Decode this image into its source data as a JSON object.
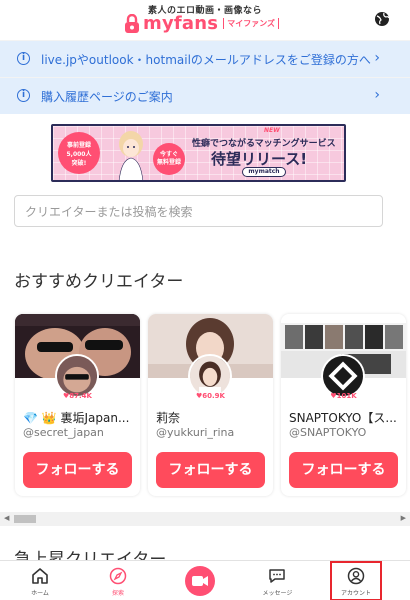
{
  "header": {
    "tagline": "素人のエロ動画・画像なら",
    "brand": "myfans",
    "brand_sub": "マイファンズ",
    "globe_icon": "globe-icon"
  },
  "notices": [
    {
      "text": "live.jpやoutlook・hotmailのメールアドレスをご登録の方へ"
    },
    {
      "text": "購入履歴ページのご案内"
    }
  ],
  "promo": {
    "badge_left": [
      "事前登録",
      "5,000人",
      "突破!"
    ],
    "badge_right": [
      "今すぐ",
      "無料登録"
    ],
    "new_label": "NEW",
    "line1": "性癖でつながるマッチングサービス",
    "line2": "待望リリース!",
    "pill": "mymatch"
  },
  "search": {
    "placeholder": "クリエイターまたは投稿を検索"
  },
  "recommended": {
    "title": "おすすめクリエイター",
    "follow_label": "フォローする",
    "cards": [
      {
        "likes": "87.4K",
        "name": "💎 👑 裏垢Japan...",
        "handle": "@secret_japan"
      },
      {
        "likes": "60.9K",
        "name": "莉奈",
        "handle": "@yukkuri_rina"
      },
      {
        "likes": "101K",
        "name": "SNAPTOKYO【ス...",
        "handle": "@SNAPTOKYO"
      }
    ]
  },
  "rising": {
    "title": "急上昇クリエイター"
  },
  "colors": {
    "accent": "#ff4b5c",
    "brand": "#ff4f73",
    "info": "#2f6fd6",
    "notice_bg": "#e2eefc"
  },
  "bottom_nav": [
    {
      "label": "ホーム",
      "icon": "home-icon"
    },
    {
      "label": "探索",
      "icon": "compass-icon"
    },
    {
      "label": "",
      "icon": "video-icon"
    },
    {
      "label": "メッセージ",
      "icon": "message-icon"
    },
    {
      "label": "アカウント",
      "icon": "user-icon"
    }
  ]
}
